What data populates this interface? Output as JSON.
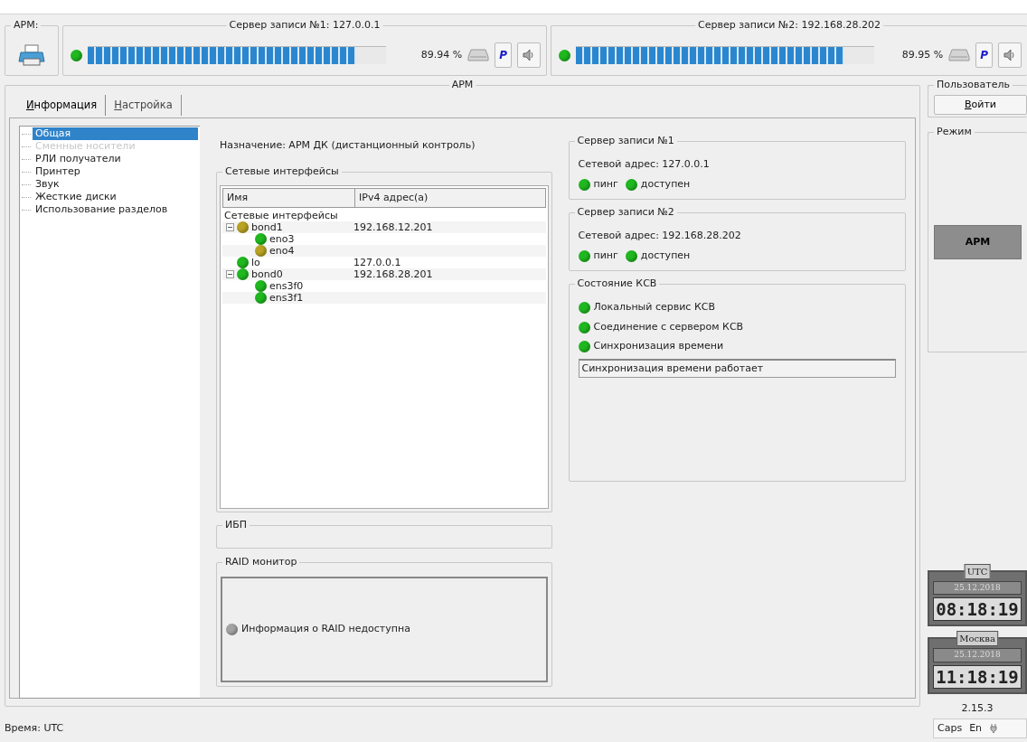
{
  "arm_box": {
    "title": "АРМ:"
  },
  "servers": [
    {
      "title": "Сервер записи №1: 127.0.0.1",
      "color": "#1fb81f",
      "level": 0.9,
      "reading": "89.94 %",
      "p_label": "P"
    },
    {
      "title": "Сервер записи №2: 192.168.28.202",
      "color": "#1fb81f",
      "level": 0.9,
      "reading": "89.95 %",
      "p_label": "P"
    }
  ],
  "main_group": {
    "title": "АРМ"
  },
  "tabs": [
    {
      "label": "Информация",
      "selected": true
    },
    {
      "label": "Настройка",
      "selected": false
    }
  ],
  "sidebar": {
    "items": [
      {
        "label": "Общая",
        "selected": true,
        "disabled": false
      },
      {
        "label": "Сменные носители",
        "selected": false,
        "disabled": true
      },
      {
        "label": "РЛИ получатели",
        "selected": false,
        "disabled": false
      },
      {
        "label": "Принтер",
        "selected": false,
        "disabled": false
      },
      {
        "label": "Звук",
        "selected": false,
        "disabled": false
      },
      {
        "label": "Жесткие диски",
        "selected": false,
        "disabled": false
      },
      {
        "label": "Использование разделов",
        "selected": false,
        "disabled": false
      }
    ]
  },
  "purpose": {
    "label": "Назначение:",
    "value": "АРМ ДК (дистанционный контроль)"
  },
  "network": {
    "title": "Сетевые интерфейсы",
    "columns": [
      "Имя",
      "IPv4 адрес(а)"
    ],
    "root": "Сетевые интерфейсы",
    "interfaces": [
      {
        "name": "bond1",
        "address": "192.168.12.201",
        "color": "#b9a323",
        "expanded": true,
        "children": [
          {
            "name": "eno3",
            "color": "#1fb81f"
          },
          {
            "name": "eno4",
            "color": "#b9a323"
          }
        ]
      },
      {
        "name": "lo",
        "address": "127.0.0.1",
        "color": "#1fb81f"
      },
      {
        "name": "bond0",
        "address": "192.168.28.201",
        "color": "#1fb81f",
        "expanded": true,
        "children": [
          {
            "name": "ens3f0",
            "color": "#1fb81f"
          },
          {
            "name": "ens3f1",
            "color": "#1fb81f"
          }
        ]
      }
    ]
  },
  "ups": {
    "title": "ИБП"
  },
  "raid": {
    "title": "RAID монитор",
    "status": {
      "text": "Информация о RAID недоступна",
      "color": "#a3a3a3"
    }
  },
  "record_servers": [
    {
      "title": "Сервер записи №1",
      "address_label": "Сетевой адрес:",
      "address": "127.0.0.1",
      "indicators": [
        {
          "label": "пинг",
          "color": "#1fb81f"
        },
        {
          "label": "доступен",
          "color": "#1fb81f"
        }
      ]
    },
    {
      "title": "Сервер записи №2",
      "address_label": "Сетевой адрес:",
      "address": "192.168.28.202",
      "indicators": [
        {
          "label": "пинг",
          "color": "#1fb81f"
        },
        {
          "label": "доступен",
          "color": "#1fb81f"
        }
      ]
    }
  ],
  "ksv": {
    "title": "Состояние КСВ",
    "items": [
      {
        "label": "Локальный сервис КСВ",
        "color": "#1fb81f"
      },
      {
        "label": "Соединение с сервером КСВ",
        "color": "#1fb81f"
      },
      {
        "label": "Синхронизация времени",
        "color": "#1fb81f"
      }
    ],
    "message": "Синхронизация времени работает"
  },
  "user": {
    "title": "Пользователь",
    "login_button": "Войти"
  },
  "mode": {
    "title": "Режим",
    "button": "АРМ"
  },
  "clocks": [
    {
      "zone": "UTC",
      "date": "25.12.2018",
      "time": "08:18:19"
    },
    {
      "zone": "Москва",
      "date": "25.12.2018",
      "time": "11:18:19"
    }
  ],
  "version": "2.15.3",
  "status_bar": {
    "left": "Время: UTC",
    "caps": "Caps",
    "layout": "En"
  }
}
